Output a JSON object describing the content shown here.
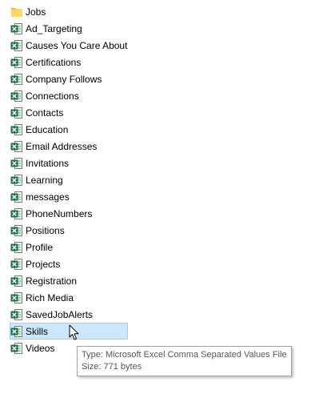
{
  "folder": {
    "name": "Jobs",
    "icon": "folder-icon"
  },
  "files": [
    {
      "name": "Ad_Targeting",
      "icon": "excel-csv-icon"
    },
    {
      "name": "Causes You Care About",
      "icon": "excel-csv-icon"
    },
    {
      "name": "Certifications",
      "icon": "excel-csv-icon"
    },
    {
      "name": "Company Follows",
      "icon": "excel-csv-icon"
    },
    {
      "name": "Connections",
      "icon": "excel-csv-icon"
    },
    {
      "name": "Contacts",
      "icon": "excel-csv-icon"
    },
    {
      "name": "Education",
      "icon": "excel-csv-icon"
    },
    {
      "name": "Email Addresses",
      "icon": "excel-csv-icon"
    },
    {
      "name": "Invitations",
      "icon": "excel-csv-icon"
    },
    {
      "name": "Learning",
      "icon": "excel-csv-icon"
    },
    {
      "name": "messages",
      "icon": "excel-csv-icon"
    },
    {
      "name": "PhoneNumbers",
      "icon": "excel-csv-icon"
    },
    {
      "name": "Positions",
      "icon": "excel-csv-icon"
    },
    {
      "name": "Profile",
      "icon": "excel-csv-icon"
    },
    {
      "name": "Projects",
      "icon": "excel-csv-icon"
    },
    {
      "name": "Registration",
      "icon": "excel-csv-icon"
    },
    {
      "name": "Rich Media",
      "icon": "excel-csv-icon"
    },
    {
      "name": "SavedJobAlerts",
      "icon": "excel-csv-icon"
    },
    {
      "name": "Skills",
      "icon": "excel-csv-icon"
    },
    {
      "name": "Videos",
      "icon": "excel-csv-icon"
    }
  ],
  "selected_file": "Skills",
  "tooltip": {
    "type_line": "Type: Microsoft Excel Comma Separated Values File",
    "size_line": "Size: 771 bytes"
  },
  "colors": {
    "selection_bg": "#cce8ff",
    "selection_border": "#99d1ff",
    "excel_green": "#1e7145",
    "folder_yellow": "#ffd766"
  }
}
